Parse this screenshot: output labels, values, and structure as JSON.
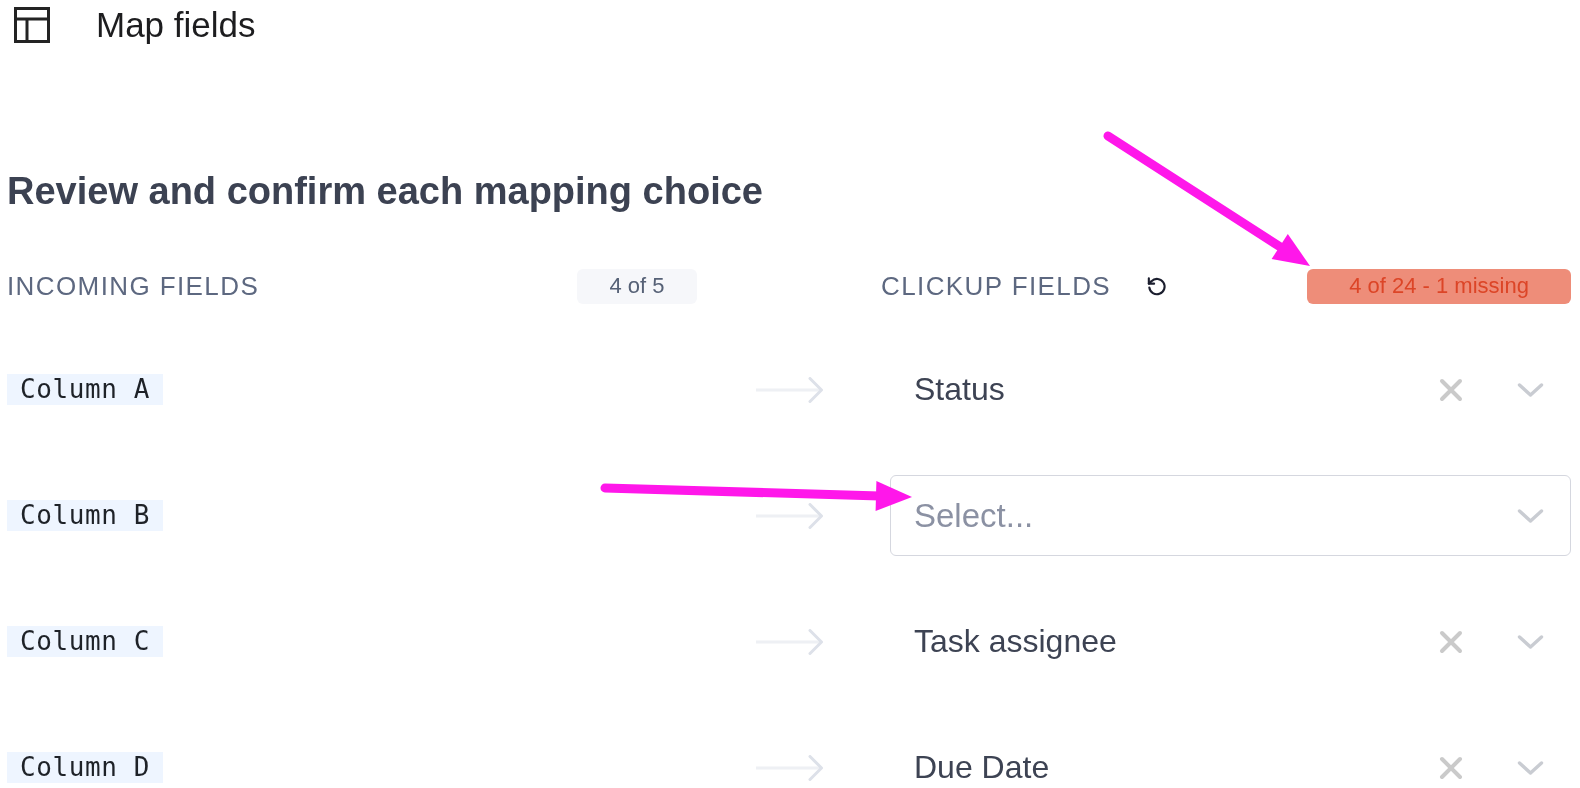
{
  "header": {
    "title": "Map fields"
  },
  "heading": "Review and confirm each mapping choice",
  "incoming": {
    "label": "INCOMING FIELDS",
    "count": "4 of 5",
    "missing": false
  },
  "clickup": {
    "label": "CLICKUP FIELDS",
    "count": "4 of 24 - 1 missing",
    "missing": true
  },
  "mappings": [
    {
      "source": "Column A",
      "target": "Status"
    },
    {
      "source": "Column B",
      "placeholder": "Select..."
    },
    {
      "source": "Column C",
      "target": "Task assignee"
    },
    {
      "source": "Column D",
      "target": "Due Date"
    }
  ]
}
